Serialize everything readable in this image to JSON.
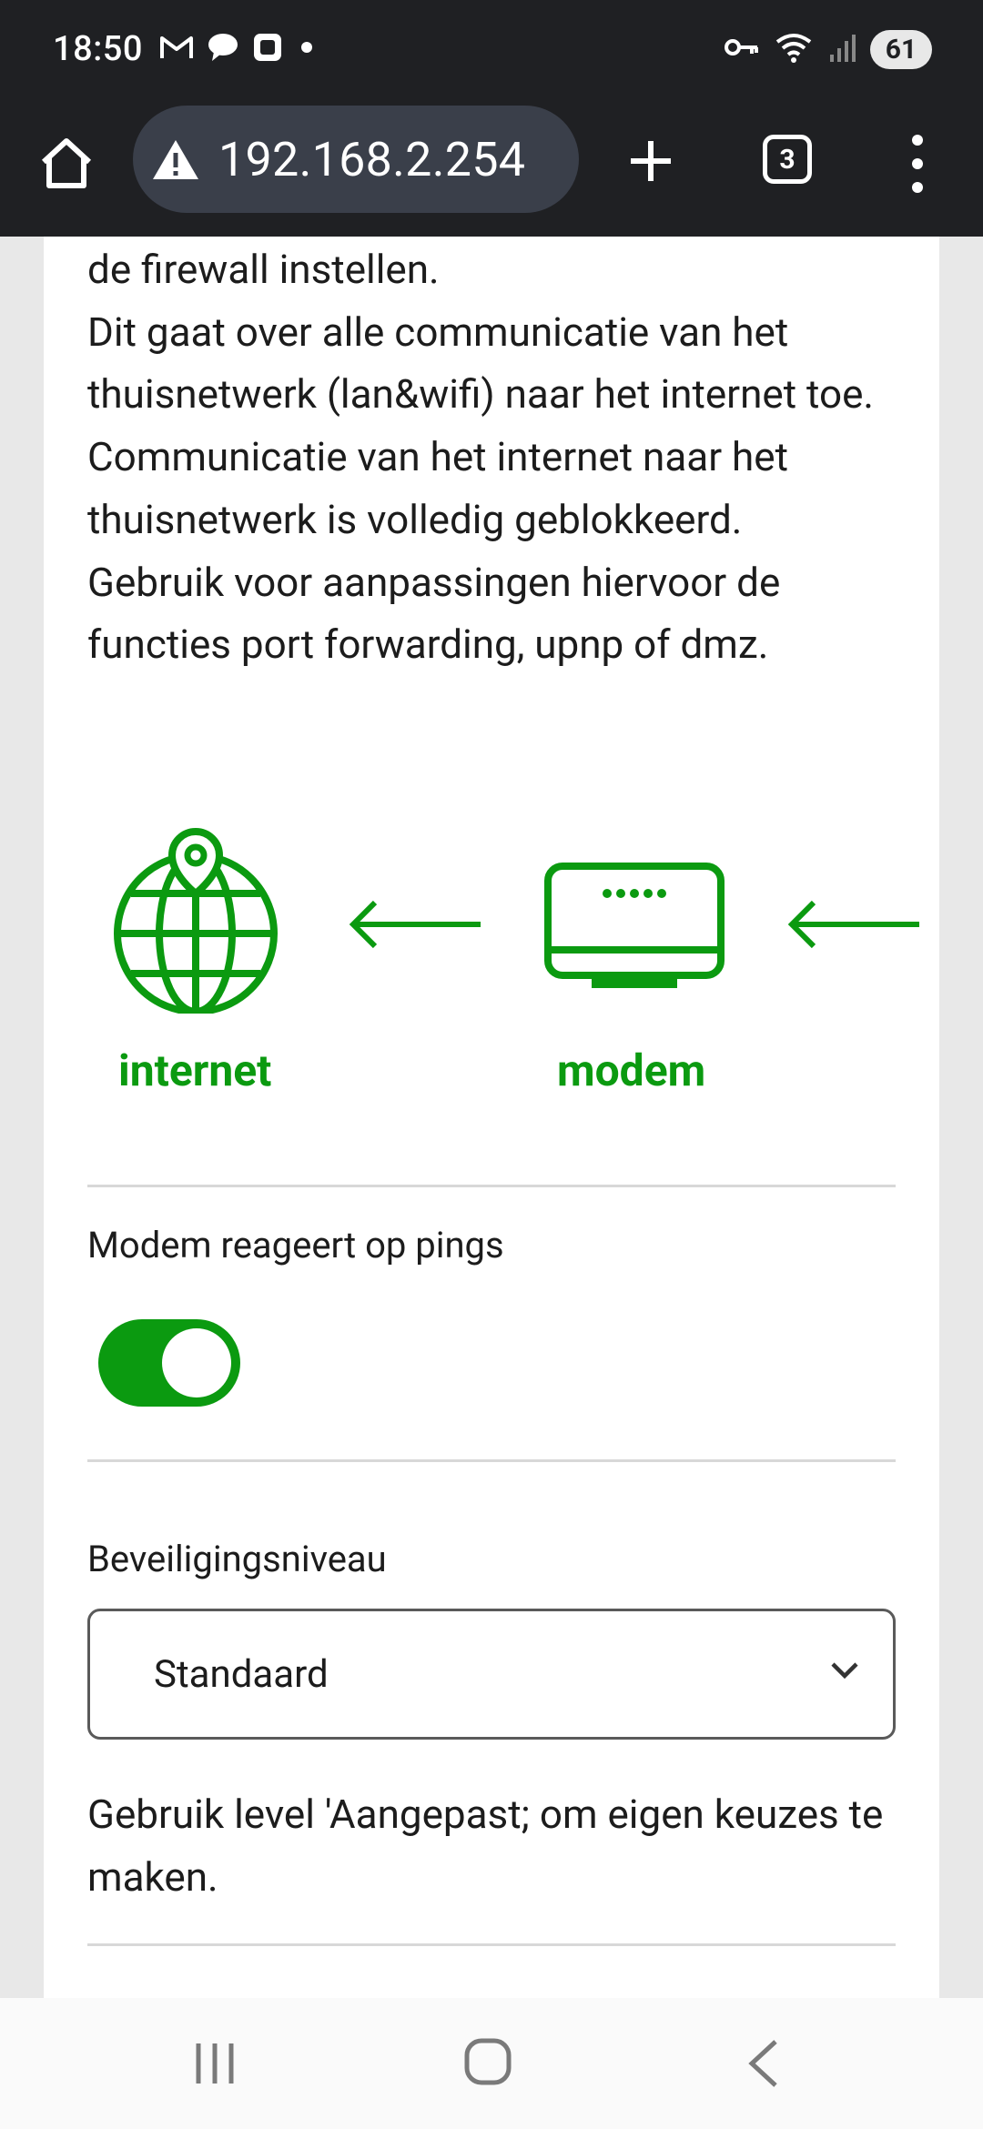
{
  "status_bar": {
    "time": "18:50",
    "battery": "61",
    "left_icons": [
      "gmail-icon",
      "chat-icon",
      "app-icon",
      "dot-icon"
    ],
    "right_icons": [
      "key-icon",
      "wifi-icon",
      "signal-icon"
    ]
  },
  "url_bar": {
    "address": "192.168.2.254",
    "tab_count": "3"
  },
  "content": {
    "intro_lines": [
      "de firewall instellen.",
      "Dit gaat over alle communicatie van het thuisnetwerk (lan&wifi) naar het internet toe.",
      "Communicatie van het internet naar het thuisnetwerk is volledig geblokkeerd.",
      "Gebruik voor aanpassingen hiervoor de functies port forwarding, upnp of dmz."
    ],
    "diagram": {
      "internet_label": "internet",
      "modem_label": "modem",
      "accent_color": "#0b9a10"
    },
    "ping_label": "Modem reageert op pings",
    "ping_enabled": true,
    "security_label": "Beveiligingsniveau",
    "security_value": "Standaard",
    "hint": "Gebruik level 'Aangepast; om eigen keuzes te maken."
  }
}
